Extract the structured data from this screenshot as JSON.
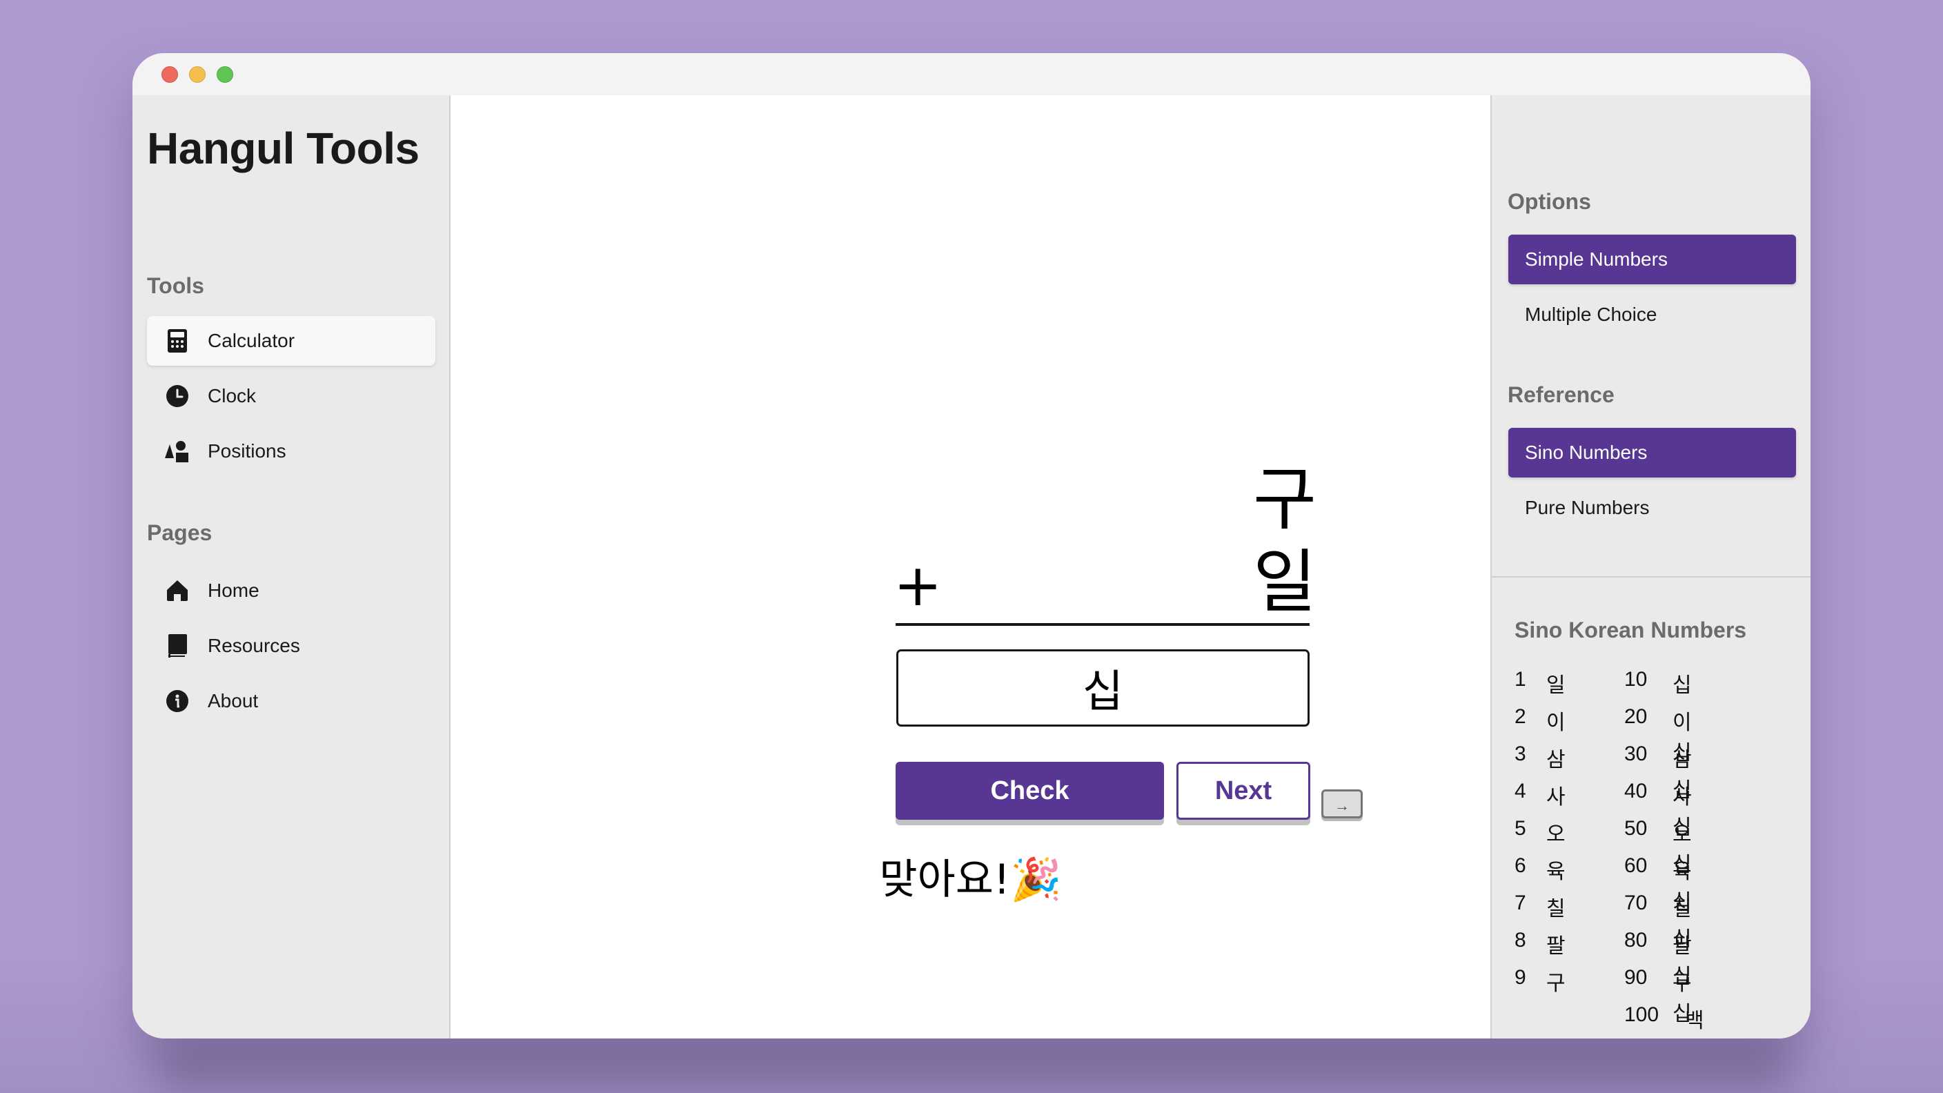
{
  "window": {
    "traffic_lights": [
      "close",
      "minimize",
      "zoom"
    ]
  },
  "sidebar": {
    "app_title": "Hangul Tools",
    "sections": [
      {
        "label": "Tools",
        "items": [
          {
            "label": "Calculator",
            "icon": "calculator-icon",
            "active": true
          },
          {
            "label": "Clock",
            "icon": "clock-icon",
            "active": false
          },
          {
            "label": "Positions",
            "icon": "shapes-icon",
            "active": false
          }
        ]
      },
      {
        "label": "Pages",
        "items": [
          {
            "label": "Home",
            "icon": "home-icon",
            "active": false
          },
          {
            "label": "Resources",
            "icon": "book-icon",
            "active": false
          },
          {
            "label": "About",
            "icon": "info-icon",
            "active": false
          }
        ]
      }
    ]
  },
  "calculator": {
    "operand_top": "구",
    "operator": "+",
    "operand_bottom": "일",
    "answer": "십",
    "check_label": "Check",
    "next_label": "Next",
    "key_hint": "→",
    "feedback": "맞아요!",
    "feedback_emoji": "🎉",
    "accent_color": "#573694"
  },
  "right_panel": {
    "options_label": "Options",
    "options": [
      {
        "label": "Simple Numbers",
        "selected": true
      },
      {
        "label": "Multiple Choice",
        "selected": false
      }
    ],
    "reference_label": "Reference",
    "reference": [
      {
        "label": "Sino Numbers",
        "selected": true
      },
      {
        "label": "Pure Numbers",
        "selected": false
      }
    ],
    "table_title": "Sino Korean Numbers",
    "ones": [
      {
        "num": "1",
        "kor": "일"
      },
      {
        "num": "2",
        "kor": "이"
      },
      {
        "num": "3",
        "kor": "삼"
      },
      {
        "num": "4",
        "kor": "사"
      },
      {
        "num": "5",
        "kor": "오"
      },
      {
        "num": "6",
        "kor": "육"
      },
      {
        "num": "7",
        "kor": "칠"
      },
      {
        "num": "8",
        "kor": "팔"
      },
      {
        "num": "9",
        "kor": "구"
      }
    ],
    "tens": [
      {
        "num": "10",
        "kor": "십"
      },
      {
        "num": "20",
        "kor": "이십"
      },
      {
        "num": "30",
        "kor": "삼십"
      },
      {
        "num": "40",
        "kor": "사십"
      },
      {
        "num": "50",
        "kor": "오십"
      },
      {
        "num": "60",
        "kor": "육십"
      },
      {
        "num": "70",
        "kor": "칠십"
      },
      {
        "num": "80",
        "kor": "팔십"
      },
      {
        "num": "90",
        "kor": "구십"
      },
      {
        "num": "100",
        "kor": "백"
      }
    ]
  }
}
